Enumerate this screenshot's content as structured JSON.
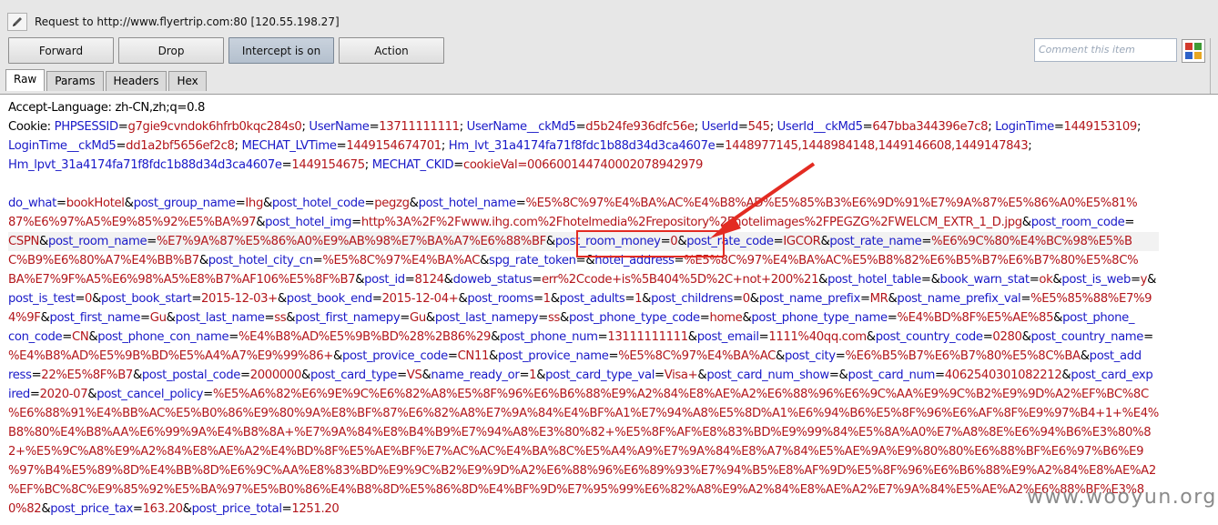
{
  "header": {
    "request_title": "Request to http://www.flyertrip.com:80  [120.55.198.27]"
  },
  "toolbar": {
    "forward_label": "Forward",
    "drop_label": "Drop",
    "intercept_label": "Intercept is on",
    "action_label": "Action",
    "comment_placeholder": "Comment this item"
  },
  "tabs": [
    {
      "label": "Raw",
      "active": true
    },
    {
      "label": "Params",
      "active": false
    },
    {
      "label": "Headers",
      "active": false
    },
    {
      "label": "Hex",
      "active": false
    }
  ],
  "colors": {
    "highlight_box": "#e32b22",
    "param_name": "#1a1ac8",
    "param_value": "#b3161b",
    "intercept_active": "#b4c0ce"
  },
  "body_lines": [
    [
      {
        "t": "Accept-Language: zh-CN,zh;q=0.8",
        "c": "blk"
      }
    ],
    [
      {
        "t": "Cookie: ",
        "c": "blk"
      },
      {
        "t": "PHPSESSID",
        "c": "blu"
      },
      {
        "t": "=",
        "c": "blk"
      },
      {
        "t": "g7gie9cvndok6hfrb0kqc284s0",
        "c": "red"
      },
      {
        "t": "; ",
        "c": "blk"
      },
      {
        "t": "UserName",
        "c": "blu"
      },
      {
        "t": "=",
        "c": "blk"
      },
      {
        "t": "13711111111",
        "c": "red"
      },
      {
        "t": "; ",
        "c": "blk"
      },
      {
        "t": "UserName__ckMd5",
        "c": "blu"
      },
      {
        "t": "=",
        "c": "blk"
      },
      {
        "t": "d5b24fe936dfc56e",
        "c": "red"
      },
      {
        "t": "; ",
        "c": "blk"
      },
      {
        "t": "UserId",
        "c": "blu"
      },
      {
        "t": "=",
        "c": "blk"
      },
      {
        "t": "545",
        "c": "red"
      },
      {
        "t": "; ",
        "c": "blk"
      },
      {
        "t": "UserId__ckMd5",
        "c": "blu"
      },
      {
        "t": "=",
        "c": "blk"
      },
      {
        "t": "647bba344396e7c8",
        "c": "red"
      },
      {
        "t": "; ",
        "c": "blk"
      },
      {
        "t": "LoginTime",
        "c": "blu"
      },
      {
        "t": "=",
        "c": "blk"
      },
      {
        "t": "1449153109",
        "c": "red"
      },
      {
        "t": ";",
        "c": "blk"
      }
    ],
    [
      {
        "t": "LoginTime__ckMd5",
        "c": "blu"
      },
      {
        "t": "=",
        "c": "blk"
      },
      {
        "t": "dd1a2bf5656ef2c8",
        "c": "red"
      },
      {
        "t": "; ",
        "c": "blk"
      },
      {
        "t": "MECHAT_LVTime",
        "c": "blu"
      },
      {
        "t": "=",
        "c": "blk"
      },
      {
        "t": "1449154674701",
        "c": "red"
      },
      {
        "t": "; ",
        "c": "blk"
      },
      {
        "t": "Hm_lvt_31a4174fa71f8fdc1b88d34d3ca4607e",
        "c": "blu"
      },
      {
        "t": "=",
        "c": "blk"
      },
      {
        "t": "1448977145,1448984148,1449146608,1449147843",
        "c": "red"
      },
      {
        "t": ";",
        "c": "blk"
      }
    ],
    [
      {
        "t": "Hm_lpvt_31a4174fa71f8fdc1b88d34d3ca4607e",
        "c": "blu"
      },
      {
        "t": "=",
        "c": "blk"
      },
      {
        "t": "1449154675",
        "c": "red"
      },
      {
        "t": "; ",
        "c": "blk"
      },
      {
        "t": "MECHAT_CKID",
        "c": "blu"
      },
      {
        "t": "=",
        "c": "blk"
      },
      {
        "t": "cookieVal=006600144740002078942979",
        "c": "red"
      }
    ],
    [
      {
        "t": "",
        "c": "blk"
      }
    ],
    [
      {
        "t": "do_what",
        "c": "blu"
      },
      {
        "t": "=",
        "c": "blk"
      },
      {
        "t": "bookHotel",
        "c": "red"
      },
      {
        "t": "&",
        "c": "blk"
      },
      {
        "t": "post_group_name",
        "c": "blu"
      },
      {
        "t": "=",
        "c": "blk"
      },
      {
        "t": "Ihg",
        "c": "red"
      },
      {
        "t": "&",
        "c": "blk"
      },
      {
        "t": "post_hotel_code",
        "c": "blu"
      },
      {
        "t": "=",
        "c": "blk"
      },
      {
        "t": "pegzg",
        "c": "red"
      },
      {
        "t": "&",
        "c": "blk"
      },
      {
        "t": "post_hotel_name",
        "c": "blu"
      },
      {
        "t": "=",
        "c": "blk"
      },
      {
        "t": "%E5%8C%97%E4%BA%AC%E4%B8%AD%E5%85%B3%E6%9D%91%E7%9A%87%E5%86%A0%E5%81%",
        "c": "red"
      }
    ],
    [
      {
        "t": "87%E6%97%A5%E9%85%92%E5%BA%97",
        "c": "red"
      },
      {
        "t": "&",
        "c": "blk"
      },
      {
        "t": "post_hotel_img",
        "c": "blu"
      },
      {
        "t": "=",
        "c": "blk"
      },
      {
        "t": "http%3A%2F%2Fwww.ihg.com%2Fhotelmedia%2Frepository%2Fhotelimages%2FPEGZG%2FWELCM_EXTR_1_D.jpg",
        "c": "red"
      },
      {
        "t": "&",
        "c": "blk"
      },
      {
        "t": "post_room_code",
        "c": "blu"
      },
      {
        "t": "=",
        "c": "blk"
      }
    ],
    [
      {
        "t": "CSPN",
        "c": "red"
      },
      {
        "t": "&",
        "c": "blk"
      },
      {
        "t": "post_room_name",
        "c": "blu"
      },
      {
        "t": "=",
        "c": "blk"
      },
      {
        "t": "%E7%9A%87%E5%86%A0%E9%AB%98%E7%BA%A7%E6%88%BF",
        "c": "red"
      },
      {
        "t": "&",
        "c": "blk"
      },
      {
        "t": "post_room_money",
        "c": "blu"
      },
      {
        "t": "=",
        "c": "blk"
      },
      {
        "t": "0",
        "c": "red"
      },
      {
        "t": "&",
        "c": "blk"
      },
      {
        "t": "post_rate_code",
        "c": "blu"
      },
      {
        "t": "=",
        "c": "blk"
      },
      {
        "t": "IGCOR",
        "c": "red"
      },
      {
        "t": "&",
        "c": "blk"
      },
      {
        "t": "post_rate_name",
        "c": "blu"
      },
      {
        "t": "=",
        "c": "blk"
      },
      {
        "t": "%E6%9C%80%E4%BC%98%E5%B",
        "c": "red"
      }
    ],
    [
      {
        "t": "C%B9%E6%80%A7%E4%BB%B7",
        "c": "red"
      },
      {
        "t": "&",
        "c": "blk"
      },
      {
        "t": "post_hotel_city_cn",
        "c": "blu"
      },
      {
        "t": "=",
        "c": "blk"
      },
      {
        "t": "%E5%8C%97%E4%BA%AC",
        "c": "red"
      },
      {
        "t": "&",
        "c": "blk"
      },
      {
        "t": "spg_rate_token",
        "c": "blu"
      },
      {
        "t": "=&",
        "c": "blk"
      },
      {
        "t": "hotel_address",
        "c": "blu"
      },
      {
        "t": "=",
        "c": "blk"
      },
      {
        "t": "%E5%8C%97%E4%BA%AC%E5%B8%82%E6%B5%B7%E6%B7%80%E5%8C%",
        "c": "red"
      }
    ],
    [
      {
        "t": "BA%E7%9F%A5%E6%98%A5%E8%B7%AF106%E5%8F%B7",
        "c": "red"
      },
      {
        "t": "&",
        "c": "blk"
      },
      {
        "t": "post_id",
        "c": "blu"
      },
      {
        "t": "=",
        "c": "blk"
      },
      {
        "t": "8124",
        "c": "red"
      },
      {
        "t": "&",
        "c": "blk"
      },
      {
        "t": "doweb_status",
        "c": "blu"
      },
      {
        "t": "=",
        "c": "blk"
      },
      {
        "t": "err%2Ccode+is%5B404%5D%2C+not+200%21",
        "c": "red"
      },
      {
        "t": "&",
        "c": "blk"
      },
      {
        "t": "post_hotel_table",
        "c": "blu"
      },
      {
        "t": "=&",
        "c": "blk"
      },
      {
        "t": "book_warn_stat",
        "c": "blu"
      },
      {
        "t": "=",
        "c": "blk"
      },
      {
        "t": "ok",
        "c": "red"
      },
      {
        "t": "&",
        "c": "blk"
      },
      {
        "t": "post_is_web",
        "c": "blu"
      },
      {
        "t": "=",
        "c": "blk"
      },
      {
        "t": "y",
        "c": "red"
      },
      {
        "t": "&",
        "c": "blk"
      }
    ],
    [
      {
        "t": "post_is_test",
        "c": "blu"
      },
      {
        "t": "=",
        "c": "blk"
      },
      {
        "t": "0",
        "c": "red"
      },
      {
        "t": "&",
        "c": "blk"
      },
      {
        "t": "post_book_start",
        "c": "blu"
      },
      {
        "t": "=",
        "c": "blk"
      },
      {
        "t": "2015-12-03+",
        "c": "red"
      },
      {
        "t": "&",
        "c": "blk"
      },
      {
        "t": "post_book_end",
        "c": "blu"
      },
      {
        "t": "=",
        "c": "blk"
      },
      {
        "t": "2015-12-04+",
        "c": "red"
      },
      {
        "t": "&",
        "c": "blk"
      },
      {
        "t": "post_rooms",
        "c": "blu"
      },
      {
        "t": "=",
        "c": "blk"
      },
      {
        "t": "1",
        "c": "red"
      },
      {
        "t": "&",
        "c": "blk"
      },
      {
        "t": "post_adults",
        "c": "blu"
      },
      {
        "t": "=",
        "c": "blk"
      },
      {
        "t": "1",
        "c": "red"
      },
      {
        "t": "&",
        "c": "blk"
      },
      {
        "t": "post_childrens",
        "c": "blu"
      },
      {
        "t": "=",
        "c": "blk"
      },
      {
        "t": "0",
        "c": "red"
      },
      {
        "t": "&",
        "c": "blk"
      },
      {
        "t": "post_name_prefix",
        "c": "blu"
      },
      {
        "t": "=",
        "c": "blk"
      },
      {
        "t": "MR",
        "c": "red"
      },
      {
        "t": "&",
        "c": "blk"
      },
      {
        "t": "post_name_prefix_val",
        "c": "blu"
      },
      {
        "t": "=",
        "c": "blk"
      },
      {
        "t": "%E5%85%88%E7%9",
        "c": "red"
      }
    ],
    [
      {
        "t": "4%9F",
        "c": "red"
      },
      {
        "t": "&",
        "c": "blk"
      },
      {
        "t": "post_first_name",
        "c": "blu"
      },
      {
        "t": "=",
        "c": "blk"
      },
      {
        "t": "Gu",
        "c": "red"
      },
      {
        "t": "&",
        "c": "blk"
      },
      {
        "t": "post_last_name",
        "c": "blu"
      },
      {
        "t": "=",
        "c": "blk"
      },
      {
        "t": "ss",
        "c": "red"
      },
      {
        "t": "&",
        "c": "blk"
      },
      {
        "t": "post_first_namepy",
        "c": "blu"
      },
      {
        "t": "=",
        "c": "blk"
      },
      {
        "t": "Gu",
        "c": "red"
      },
      {
        "t": "&",
        "c": "blk"
      },
      {
        "t": "post_last_namepy",
        "c": "blu"
      },
      {
        "t": "=",
        "c": "blk"
      },
      {
        "t": "ss",
        "c": "red"
      },
      {
        "t": "&",
        "c": "blk"
      },
      {
        "t": "post_phone_type_code",
        "c": "blu"
      },
      {
        "t": "=",
        "c": "blk"
      },
      {
        "t": "home",
        "c": "red"
      },
      {
        "t": "&",
        "c": "blk"
      },
      {
        "t": "post_phone_type_name",
        "c": "blu"
      },
      {
        "t": "=",
        "c": "blk"
      },
      {
        "t": "%E4%BD%8F%E5%AE%85",
        "c": "red"
      },
      {
        "t": "&",
        "c": "blk"
      },
      {
        "t": "post_phone_",
        "c": "blu"
      }
    ],
    [
      {
        "t": "con_code",
        "c": "blu"
      },
      {
        "t": "=",
        "c": "blk"
      },
      {
        "t": "CN",
        "c": "red"
      },
      {
        "t": "&",
        "c": "blk"
      },
      {
        "t": "post_phone_con_name",
        "c": "blu"
      },
      {
        "t": "=",
        "c": "blk"
      },
      {
        "t": "%E4%B8%AD%E5%9B%BD%28%2B86%29",
        "c": "red"
      },
      {
        "t": "&",
        "c": "blk"
      },
      {
        "t": "post_phone_num",
        "c": "blu"
      },
      {
        "t": "=",
        "c": "blk"
      },
      {
        "t": "13111111111",
        "c": "red"
      },
      {
        "t": "&",
        "c": "blk"
      },
      {
        "t": "post_email",
        "c": "blu"
      },
      {
        "t": "=",
        "c": "blk"
      },
      {
        "t": "1111%40qq.com",
        "c": "red"
      },
      {
        "t": "&",
        "c": "blk"
      },
      {
        "t": "post_country_code",
        "c": "blu"
      },
      {
        "t": "=",
        "c": "blk"
      },
      {
        "t": "0280",
        "c": "red"
      },
      {
        "t": "&",
        "c": "blk"
      },
      {
        "t": "post_country_name",
        "c": "blu"
      },
      {
        "t": "=",
        "c": "blk"
      }
    ],
    [
      {
        "t": "%E4%B8%AD%E5%9B%BD%E5%A4%A7%E9%99%86+",
        "c": "red"
      },
      {
        "t": "&",
        "c": "blk"
      },
      {
        "t": "post_provice_code",
        "c": "blu"
      },
      {
        "t": "=",
        "c": "blk"
      },
      {
        "t": "CN11",
        "c": "red"
      },
      {
        "t": "&",
        "c": "blk"
      },
      {
        "t": "post_provice_name",
        "c": "blu"
      },
      {
        "t": "=",
        "c": "blk"
      },
      {
        "t": "%E5%8C%97%E4%BA%AC",
        "c": "red"
      },
      {
        "t": "&",
        "c": "blk"
      },
      {
        "t": "post_city",
        "c": "blu"
      },
      {
        "t": "=",
        "c": "blk"
      },
      {
        "t": "%E6%B5%B7%E6%B7%80%E5%8C%BA",
        "c": "red"
      },
      {
        "t": "&",
        "c": "blk"
      },
      {
        "t": "post_add",
        "c": "blu"
      }
    ],
    [
      {
        "t": "ress",
        "c": "blu"
      },
      {
        "t": "=",
        "c": "blk"
      },
      {
        "t": "22%E5%8F%B7",
        "c": "red"
      },
      {
        "t": "&",
        "c": "blk"
      },
      {
        "t": "post_postal_code",
        "c": "blu"
      },
      {
        "t": "=",
        "c": "blk"
      },
      {
        "t": "2000000",
        "c": "red"
      },
      {
        "t": "&",
        "c": "blk"
      },
      {
        "t": "post_card_type",
        "c": "blu"
      },
      {
        "t": "=",
        "c": "blk"
      },
      {
        "t": "VS",
        "c": "red"
      },
      {
        "t": "&",
        "c": "blk"
      },
      {
        "t": "name_ready_or",
        "c": "blu"
      },
      {
        "t": "=",
        "c": "blk"
      },
      {
        "t": "1",
        "c": "red"
      },
      {
        "t": "&",
        "c": "blk"
      },
      {
        "t": "post_card_type_val",
        "c": "blu"
      },
      {
        "t": "=",
        "c": "blk"
      },
      {
        "t": "Visa+",
        "c": "red"
      },
      {
        "t": "&",
        "c": "blk"
      },
      {
        "t": "post_card_num_show",
        "c": "blu"
      },
      {
        "t": "=&",
        "c": "blk"
      },
      {
        "t": "post_card_num",
        "c": "blu"
      },
      {
        "t": "=",
        "c": "blk"
      },
      {
        "t": "4062540301082212",
        "c": "red"
      },
      {
        "t": "&",
        "c": "blk"
      },
      {
        "t": "post_card_exp",
        "c": "blu"
      }
    ],
    [
      {
        "t": "ired",
        "c": "blu"
      },
      {
        "t": "=",
        "c": "blk"
      },
      {
        "t": "2020-07",
        "c": "red"
      },
      {
        "t": "&",
        "c": "blk"
      },
      {
        "t": "post_cancel_policy",
        "c": "blu"
      },
      {
        "t": "=",
        "c": "blk"
      },
      {
        "t": "%E5%A6%82%E6%9E%9C%E6%82%A8%E5%8F%96%E6%B6%88%E9%A2%84%E8%AE%A2%E6%88%96%E6%9C%AA%E9%9C%B2%E9%9D%A2%EF%BC%8C",
        "c": "red"
      }
    ],
    [
      {
        "t": "%E6%88%91%E4%BB%AC%E5%B0%86%E9%80%9A%E8%BF%87%E6%82%A8%E7%9A%84%E4%BF%A1%E7%94%A8%E5%8D%A1%E6%94%B6%E5%8F%96%E6%AF%8F%E9%97%B4+1+%E4%",
        "c": "red"
      }
    ],
    [
      {
        "t": "B8%80%E4%B8%AA%E6%99%9A%E4%B8%8A+%E7%9A%84%E8%B4%B9%E7%94%A8%E3%80%82+%E5%8F%AF%E8%83%BD%E9%99%84%E5%8A%A0%E7%A8%8E%E6%94%B6%E3%80%8",
        "c": "red"
      }
    ],
    [
      {
        "t": "2+%E5%9C%A8%E9%A2%84%E8%AE%A2%E4%BD%8F%E5%AE%BF%E7%AC%AC%E4%BA%8C%E5%A4%A9%E7%9A%84%E8%A7%84%E5%AE%9A%E9%80%80%E6%88%BF%E6%97%B6%E9",
        "c": "red"
      }
    ],
    [
      {
        "t": "%97%B4%E5%89%8D%E4%BB%8D%E6%9C%AA%E8%83%BD%E9%9C%B2%E9%9D%A2%E6%88%96%E6%89%93%E7%94%B5%E8%AF%9D%E5%8F%96%E6%B6%88%E9%A2%84%E8%AE%A2",
        "c": "red"
      }
    ],
    [
      {
        "t": "%EF%BC%8C%E9%85%92%E5%BA%97%E5%B0%86%E4%B8%8D%E5%86%8D%E4%BF%9D%E7%95%99%E6%82%A8%E9%A2%84%E8%AE%A2%E7%9A%84%E5%AE%A2%E6%88%BF%E3%8",
        "c": "red"
      }
    ],
    [
      {
        "t": "0%82",
        "c": "red"
      },
      {
        "t": "&",
        "c": "blk"
      },
      {
        "t": "post_price_tax",
        "c": "blu"
      },
      {
        "t": "=",
        "c": "blk"
      },
      {
        "t": "163.20",
        "c": "red"
      },
      {
        "t": "&",
        "c": "blk"
      },
      {
        "t": "post_price_total",
        "c": "blu"
      },
      {
        "t": "=",
        "c": "blk"
      },
      {
        "t": "1251.20",
        "c": "red"
      }
    ]
  ],
  "watermark": "www.wooyun.org"
}
